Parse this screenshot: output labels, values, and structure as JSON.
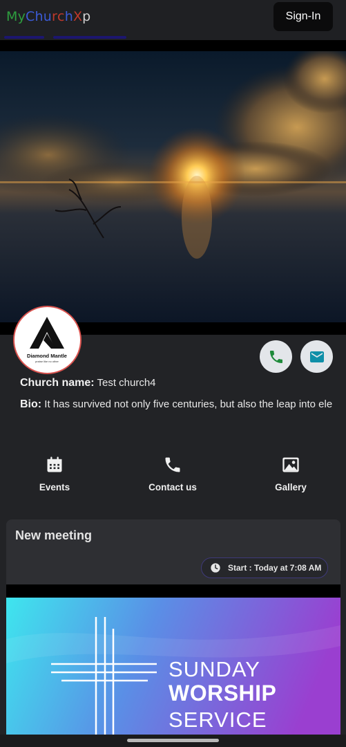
{
  "app": {
    "brand_letters": [
      {
        "ch": "M",
        "color": "#2e9e3f"
      },
      {
        "ch": "y",
        "color": "#2e9e3f"
      },
      {
        "ch": "C",
        "color": "#3b5bd6"
      },
      {
        "ch": "h",
        "color": "#3b5bd6"
      },
      {
        "ch": "u",
        "color": "#3b5bd6"
      },
      {
        "ch": "r",
        "color": "#c0392b"
      },
      {
        "ch": "c",
        "color": "#c0392b"
      },
      {
        "ch": "h",
        "color": "#3b5bd6"
      },
      {
        "ch": "X",
        "color": "#c0392b"
      },
      {
        "ch": "p",
        "color": "#d0d0d0"
      }
    ],
    "sign_in_label": "Sign-In"
  },
  "church": {
    "logo_text": "Diamond Mantle",
    "logo_tagline": "praise like no other",
    "name_label": "Church name:",
    "name_value": "Test church4",
    "bio_label": "Bio:",
    "bio_value": "It has survived not only five centuries, but also the leap into ele",
    "call_icon": "phone-icon",
    "mail_icon": "mail-icon"
  },
  "actions": [
    {
      "label": "Events",
      "icon": "calendar-icon"
    },
    {
      "label": "Contact us",
      "icon": "phone-icon"
    },
    {
      "label": "Gallery",
      "icon": "image-icon"
    }
  ],
  "meeting": {
    "title": "New meeting",
    "start_label": "Start : Today at 7:08 AM",
    "banner_line1": "SUNDAY",
    "banner_line2": "WORSHIP",
    "banner_line3": "SERVICE"
  },
  "colors": {
    "accent_indicator": "#1c1670",
    "call_green": "#1e8a3a",
    "mail_teal": "#0f8fa8"
  }
}
